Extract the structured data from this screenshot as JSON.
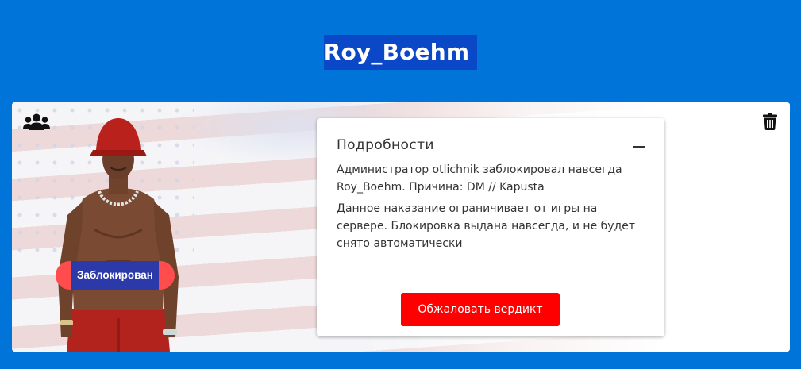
{
  "header": {
    "username": "Roy_Boehm"
  },
  "card": {
    "status_badge": "Заблокирован",
    "group_icon": "users-group-icon",
    "delete_icon": "trash-icon"
  },
  "details": {
    "title": "Подробности",
    "collapse_icon": "minus-icon",
    "paragraph_1": "Администратор otlichnik заблокировал навсегда Roy_Boehm. Причина: DM // Kapusta",
    "paragraph_2": "Данное наказание ограничивает от игры на сервере. Блокировка выдана навсегда, и не будет снято автоматически",
    "appeal_button": "Обжаловать вердикт"
  },
  "colors": {
    "page_background": "#0074d9",
    "title_highlight": "#0a48c8",
    "badge_pill": "#ff4d4d",
    "badge_text_bg": "#2b3aa8",
    "appeal_button": "#ff0000"
  }
}
